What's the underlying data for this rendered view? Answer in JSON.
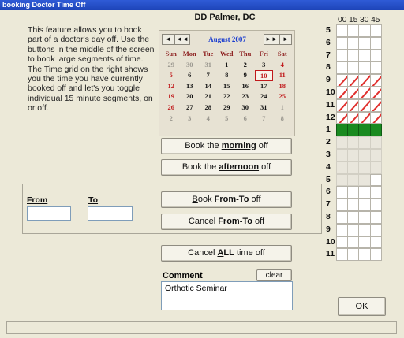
{
  "window": {
    "title": "booking Doctor Time Off"
  },
  "intro_text": "This feature allows you to book part of a doctor's day off. Use the buttons in the middle of the screen to book large segments of time. The Time grid on the right shows you the time you have currently booked off and let's you toggle individual 15 minute segments, on or off.",
  "doctor_name": "DD Palmer, DC",
  "calendar": {
    "month_label": "August 2007",
    "nav": {
      "prev_month": "◄",
      "prev_year": "◄◄",
      "next_year": "►►",
      "next_month": "►"
    },
    "weekdays": [
      "Sun",
      "Mon",
      "Tue",
      "Wed",
      "Thu",
      "Fri",
      "Sat"
    ],
    "weeks": [
      [
        {
          "d": "29",
          "t": "dim"
        },
        {
          "d": "30",
          "t": "dim"
        },
        {
          "d": "31",
          "t": "dim"
        },
        {
          "d": "1",
          "t": "cur"
        },
        {
          "d": "2",
          "t": "cur"
        },
        {
          "d": "3",
          "t": "cur"
        },
        {
          "d": "4",
          "t": "sun"
        }
      ],
      [
        {
          "d": "5",
          "t": "sun"
        },
        {
          "d": "6",
          "t": "cur"
        },
        {
          "d": "7",
          "t": "cur"
        },
        {
          "d": "8",
          "t": "cur"
        },
        {
          "d": "9",
          "t": "cur"
        },
        {
          "d": "10",
          "t": "sel"
        },
        {
          "d": "11",
          "t": "sun"
        }
      ],
      [
        {
          "d": "12",
          "t": "sun"
        },
        {
          "d": "13",
          "t": "cur"
        },
        {
          "d": "14",
          "t": "cur"
        },
        {
          "d": "15",
          "t": "cur"
        },
        {
          "d": "16",
          "t": "cur"
        },
        {
          "d": "17",
          "t": "cur"
        },
        {
          "d": "18",
          "t": "sun"
        }
      ],
      [
        {
          "d": "19",
          "t": "sun"
        },
        {
          "d": "20",
          "t": "cur"
        },
        {
          "d": "21",
          "t": "cur"
        },
        {
          "d": "22",
          "t": "cur"
        },
        {
          "d": "23",
          "t": "cur"
        },
        {
          "d": "24",
          "t": "cur"
        },
        {
          "d": "25",
          "t": "sun"
        }
      ],
      [
        {
          "d": "26",
          "t": "sun"
        },
        {
          "d": "27",
          "t": "cur"
        },
        {
          "d": "28",
          "t": "cur"
        },
        {
          "d": "29",
          "t": "cur"
        },
        {
          "d": "30",
          "t": "cur"
        },
        {
          "d": "31",
          "t": "cur"
        },
        {
          "d": "1",
          "t": "dim"
        }
      ],
      [
        {
          "d": "2",
          "t": "dim"
        },
        {
          "d": "3",
          "t": "dim"
        },
        {
          "d": "4",
          "t": "dim"
        },
        {
          "d": "5",
          "t": "dim"
        },
        {
          "d": "6",
          "t": "dim"
        },
        {
          "d": "7",
          "t": "dim"
        },
        {
          "d": "8",
          "t": "dim"
        }
      ]
    ]
  },
  "buttons": {
    "morning": {
      "pre": "Book the ",
      "key": "morning",
      "post": " off"
    },
    "afternoon": {
      "pre": "Book the ",
      "key": "afternoon",
      "post": " off"
    },
    "book_from_to": {
      "key": "B",
      "pre": "ook ",
      "bold": "From-To",
      "post": " off"
    },
    "cancel_from_to": {
      "key": "C",
      "pre": "ancel ",
      "bold": "From-To",
      "post": " off"
    },
    "cancel_all": {
      "pre": "Cancel ",
      "bold_key": "A",
      "bold": "LL",
      "post": " time off"
    },
    "clear": "clear",
    "ok": "OK"
  },
  "from_to": {
    "from_label": "From",
    "to_label": "To",
    "from_value": "",
    "to_value": ""
  },
  "comment": {
    "label": "Comment",
    "value": "Orthotic Seminar"
  },
  "time_grid": {
    "header": "00 15 30 45",
    "rows": [
      {
        "hour": "5",
        "cells": [
          "f",
          "f",
          "f",
          "f"
        ]
      },
      {
        "hour": "6",
        "cells": [
          "f",
          "f",
          "f",
          "f"
        ]
      },
      {
        "hour": "7",
        "cells": [
          "f",
          "f",
          "f",
          "f"
        ]
      },
      {
        "hour": "8",
        "cells": [
          "f",
          "f",
          "f",
          "f"
        ]
      },
      {
        "hour": "9",
        "cells": [
          "h",
          "h",
          "h",
          "h"
        ]
      },
      {
        "hour": "10",
        "cells": [
          "h",
          "h",
          "h",
          "h"
        ]
      },
      {
        "hour": "11",
        "cells": [
          "h",
          "h",
          "h",
          "h"
        ]
      },
      {
        "hour": "12",
        "cells": [
          "h",
          "h",
          "h",
          "h"
        ]
      },
      {
        "hour": "1",
        "cells": [
          "b",
          "b",
          "b",
          "b"
        ]
      },
      {
        "hour": "2",
        "cells": [
          "o",
          "o",
          "o",
          "o"
        ]
      },
      {
        "hour": "3",
        "cells": [
          "o",
          "o",
          "o",
          "o"
        ]
      },
      {
        "hour": "4",
        "cells": [
          "o",
          "o",
          "o",
          "o"
        ]
      },
      {
        "hour": "5",
        "cells": [
          "o",
          "o",
          "o",
          "f"
        ]
      },
      {
        "hour": "6",
        "cells": [
          "f",
          "f",
          "f",
          "f"
        ]
      },
      {
        "hour": "7",
        "cells": [
          "f",
          "f",
          "f",
          "f"
        ]
      },
      {
        "hour": "8",
        "cells": [
          "f",
          "f",
          "f",
          "f"
        ]
      },
      {
        "hour": "9",
        "cells": [
          "f",
          "f",
          "f",
          "f"
        ]
      },
      {
        "hour": "10",
        "cells": [
          "f",
          "f",
          "f",
          "f"
        ]
      },
      {
        "hour": "11",
        "cells": [
          "f",
          "f",
          "f",
          "f"
        ]
      }
    ]
  },
  "colors": {
    "booked": "#1a8a20",
    "hatch": "#e0302d",
    "month_title": "#1b3dcf",
    "weekend": "#c0191b"
  }
}
